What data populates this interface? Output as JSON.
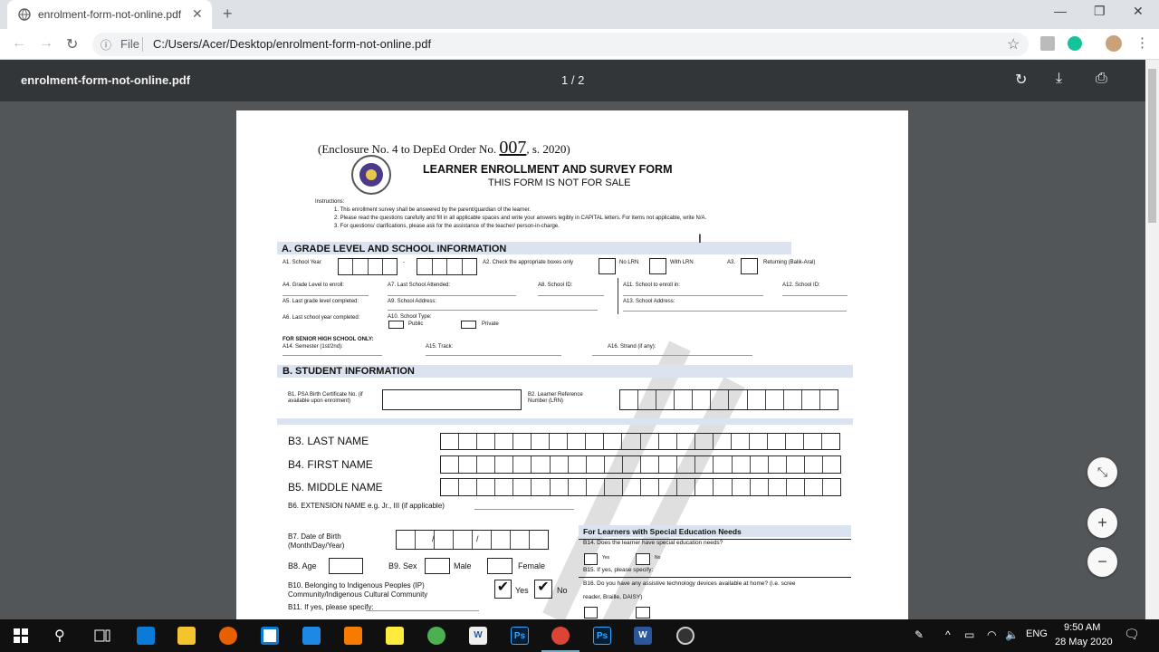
{
  "tab": {
    "title": "enrolment-form-not-online.pdf",
    "close": "✕",
    "new": "+"
  },
  "window": {
    "minimize": "—",
    "maximize": "❐",
    "close": "✕"
  },
  "nav": {
    "back": "←",
    "forward": "→",
    "reload": "↻"
  },
  "address": {
    "info": "ⓘ",
    "file_label": "File",
    "url": "C:/Users/Acer/Desktop/enrolment-form-not-online.pdf",
    "star": "☆"
  },
  "pdf": {
    "title": "enrolment-form-not-online.pdf",
    "page": "1 / 2",
    "rotate": "↻",
    "download": "⤓",
    "print": "⎙"
  },
  "form": {
    "enclosure_pre": "(Enclosure No. 4 to DepEd Order No.",
    "order_no": "007",
    "enclosure_post": ", s. 2020)",
    "title": "LEARNER ENROLLMENT AND SURVEY FORM",
    "subtitle": "THIS FORM IS NOT FOR SALE",
    "instructions_label": "Instructions:",
    "instructions": [
      "1.    This enrollment survey shall be answered by the parent/guardian of the learner.",
      "2.    Please read the questions carefully and fill in all applicable spaces and write your answers legibly in CAPITAL letters. For items not applicable, write N/A.",
      "3.    For questions/ clarifications, please ask for the assistance of the teacher/ person-in-charge."
    ],
    "secA": "A.   GRADE LEVEL AND SCHOOL INFORMATION",
    "a1": "A1. School Year",
    "a1_dash": "-",
    "a2": "A2. Check the appropriate boxes only",
    "no_lrn": "No LRN",
    "with_lrn": "With LRN",
    "a3": "A3.",
    "returning": "Returning (Balik-Aral)",
    "a4": "A4. Grade Level to enroll:",
    "a7": "A7. Last School Attended:",
    "a8": "A8. School ID:",
    "a11": "A11. School to enroll in:",
    "a12": "A12. School ID:",
    "a5": "A5. Last grade level completed:",
    "a9": "A9. School Address:",
    "a13": "A13. School Address:",
    "a6": "A6. Last school year completed:",
    "a10": "A10. School Type:",
    "public": "Public",
    "private": "Private",
    "shs": "FOR SENIOR HIGH SCHOOL ONLY:",
    "a14": "A14. Semester (1st/2nd):",
    "a15": "A15. Track:",
    "a16": "A16. Strand (if any):",
    "secB": "B. STUDENT INFORMATION",
    "b1": "B1. PSA Birth Certificate No. (if",
    "b1b": "available upon enrolment)",
    "b2": "B2. Learner Reference",
    "b2b": "Number (LRN)",
    "b3": "B3. LAST NAME",
    "b4": "B4. FIRST NAME",
    "b5": "B5. MIDDLE NAME",
    "b6": "B6. EXTENSION NAME e.g. Jr., III (if applicable)",
    "b7a": "B7.   Date   of   Birth",
    "b7b": "(Month/Day/Year)",
    "slash": "/",
    "b8": "B8. Age",
    "b9": "B9. Sex",
    "male": "Male",
    "female": "Female",
    "b10a": "B10.   Belonging   to   Indigenous   Peoples   (IP)",
    "b10b": "Community/Indigenous Cultural Community",
    "yes": "Yes",
    "no": "No",
    "check": "✔",
    "b11": "B11. If yes, please specify:",
    "sped": "For Learners with Special Education Needs",
    "b14": "B14. Does the learner have special education needs?",
    "yes_s": "Yes",
    "no_s": "No",
    "b15": "B15. If yes, please specify:",
    "b16a": "B16. Do you have any assistive technology devices available at home? (i.e. scree",
    "b16b": "reader, Braille, DAISY)"
  },
  "zoom": {
    "fit": "⤡",
    "in": "+",
    "out": "−"
  },
  "taskbar": {
    "search": "⚲",
    "time": "9:50 AM",
    "date": "28 May 2020",
    "lang": "ENG",
    "word": "W",
    "ps": "Ps",
    "notif": "🗨",
    "caret": "^",
    "ink": "✎",
    "battery": "▭",
    "wifi": "◠",
    "sound": "🔈"
  }
}
